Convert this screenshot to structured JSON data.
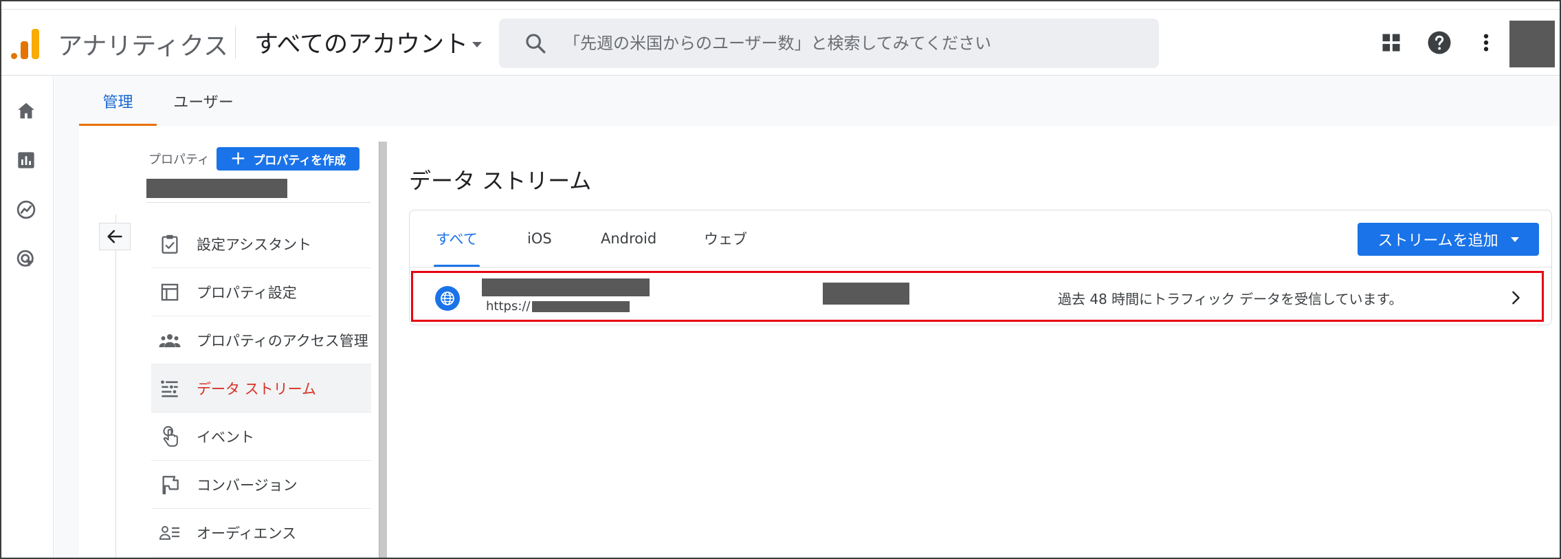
{
  "header": {
    "app_title": "アナリティクス",
    "account_selector": "すべてのアカウント",
    "search_placeholder": "「先週の米国からのユーザー数」と検索してみてください"
  },
  "admin_tabs": [
    {
      "label": "管理",
      "active": true
    },
    {
      "label": "ユーザー",
      "active": false
    }
  ],
  "property": {
    "label": "プロパティ",
    "create_button": "プロパティを作成"
  },
  "menu": {
    "items": [
      {
        "label": "設定アシスタント",
        "icon": "checklist-icon",
        "active": false
      },
      {
        "label": "プロパティ設定",
        "icon": "property-settings-icon",
        "active": false
      },
      {
        "label": "プロパティのアクセス管理",
        "icon": "people-icon",
        "active": false
      },
      {
        "label": "データ ストリーム",
        "icon": "data-streams-icon",
        "active": true
      },
      {
        "label": "イベント",
        "icon": "touch-icon",
        "active": false
      },
      {
        "label": "コンバージョン",
        "icon": "flag-icon",
        "active": false
      },
      {
        "label": "オーディエンス",
        "icon": "audience-icon",
        "active": false
      }
    ]
  },
  "data_streams": {
    "title": "データ ストリーム",
    "tabs": [
      {
        "label": "すべて",
        "active": true
      },
      {
        "label": "iOS",
        "active": false
      },
      {
        "label": "Android",
        "active": false
      },
      {
        "label": "ウェブ",
        "active": false
      }
    ],
    "add_stream_button": "ストリームを追加",
    "stream": {
      "url_prefix": "https://",
      "status": "過去 48 時間にトラフィック データを受信しています。"
    }
  },
  "colors": {
    "accent_blue": "#1a73e8",
    "tab_indicator_orange": "#e8710a",
    "active_menu_red": "#d93025",
    "highlight_border": "#e60012",
    "redaction": "#595959"
  }
}
